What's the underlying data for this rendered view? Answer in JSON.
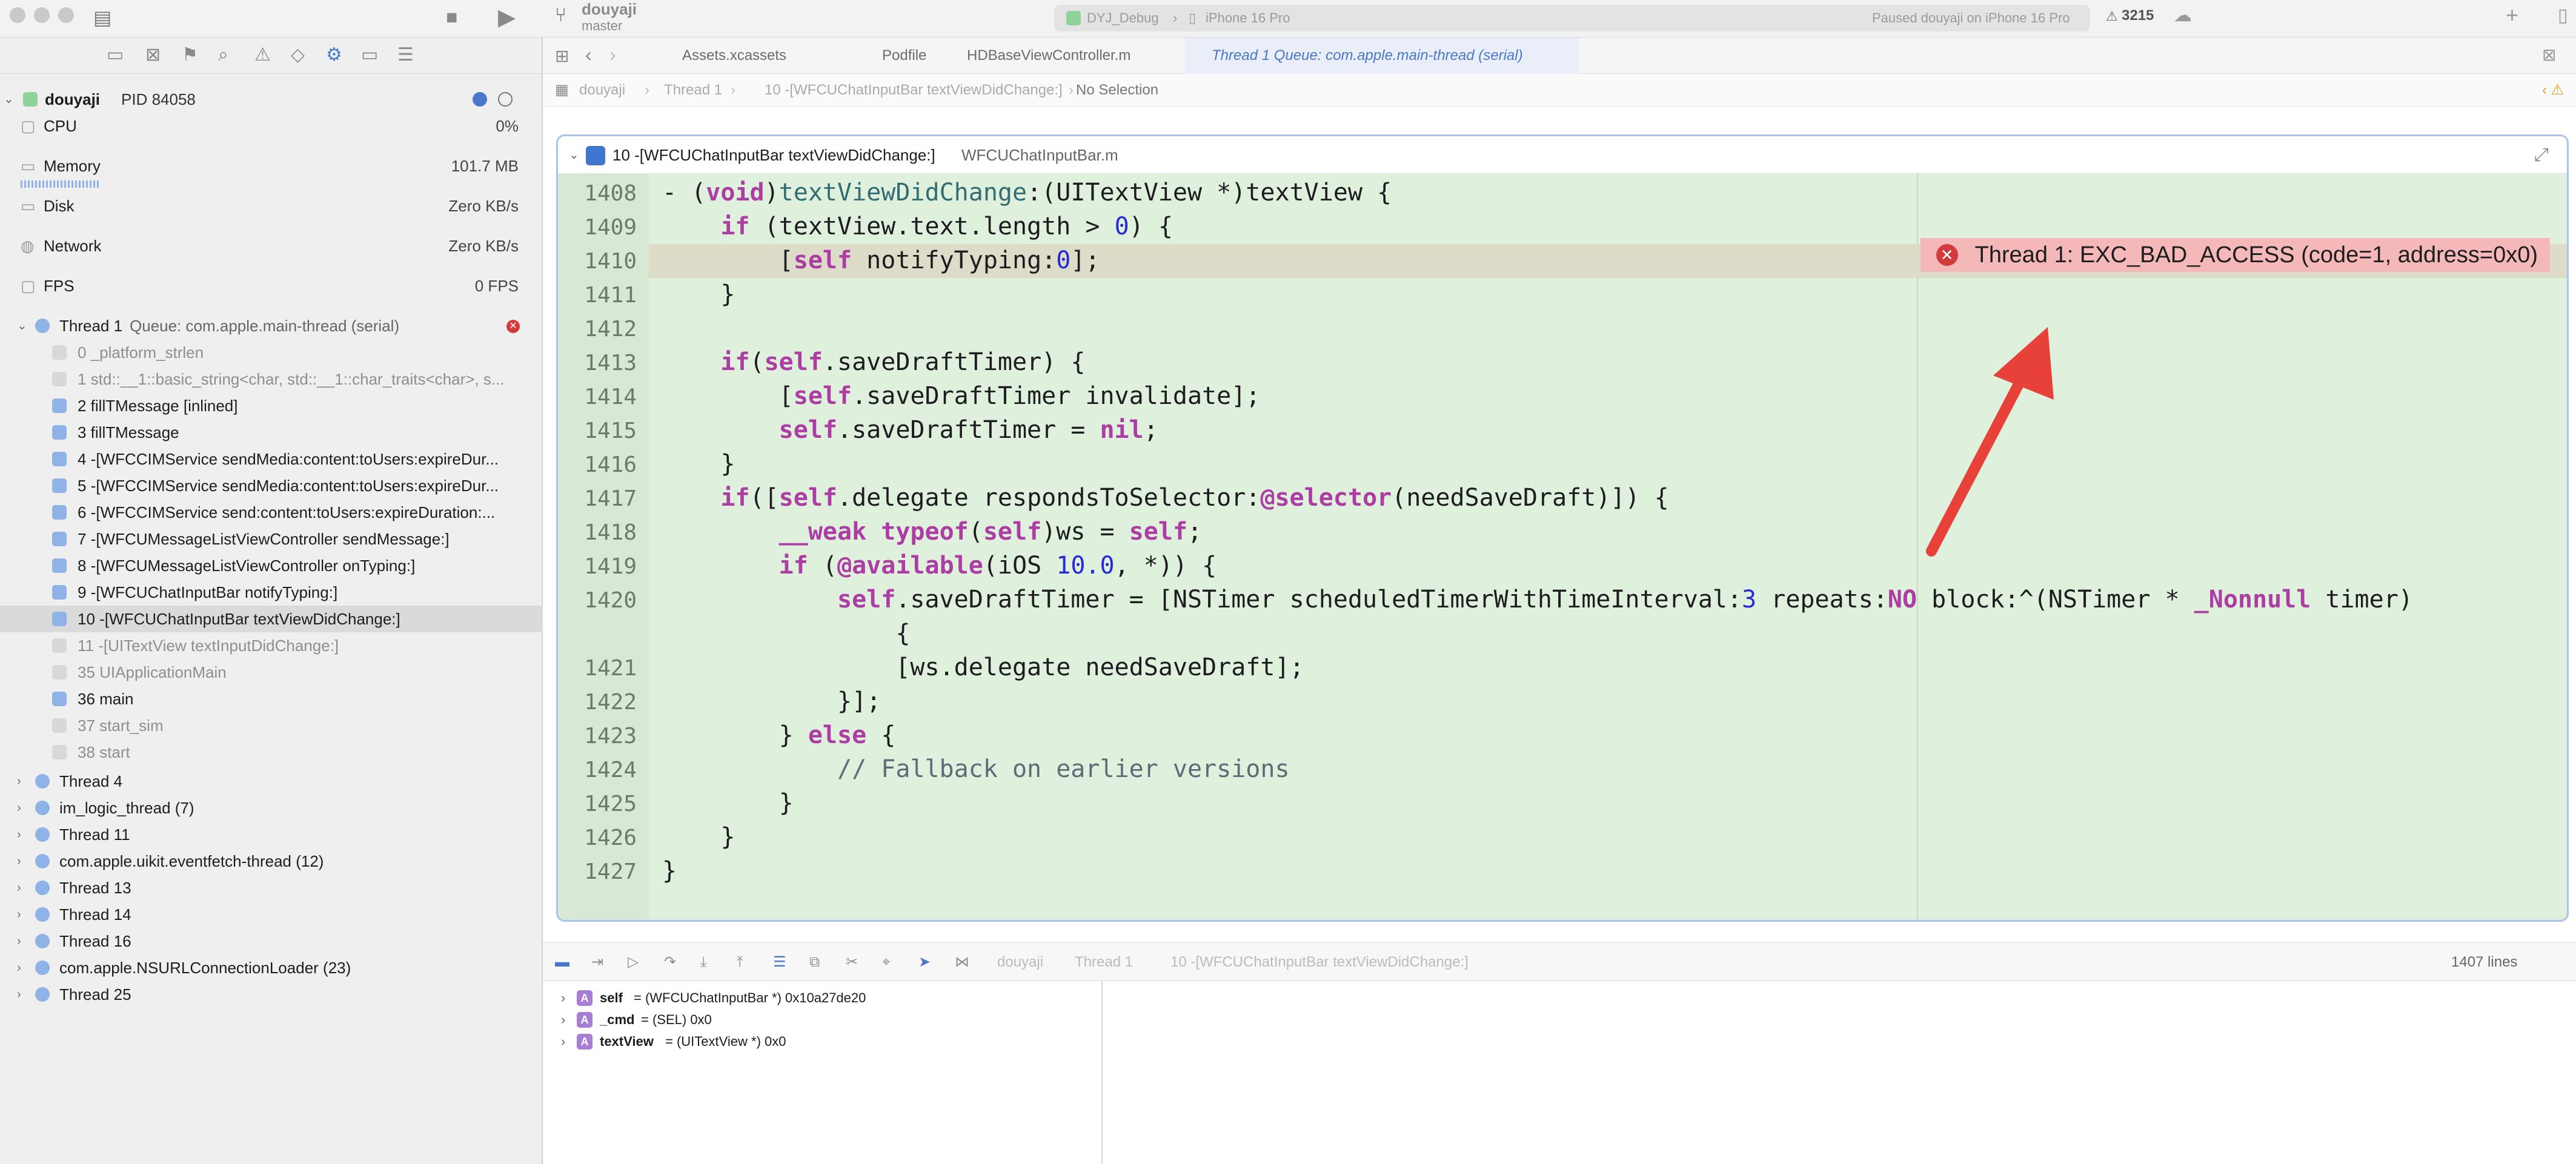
{
  "titlebar": {
    "project": "douyaji",
    "branch": "master",
    "scheme": "DYJ_Debug",
    "device": "iPhone 16 Pro",
    "status": "Paused douyaji on iPhone 16 Pro",
    "badge_count": "3215"
  },
  "navigator": {
    "process": "douyaji",
    "pid": "PID 84058",
    "gauges": [
      {
        "name": "CPU",
        "value": "0%"
      },
      {
        "name": "Memory",
        "value": "101.7 MB"
      },
      {
        "name": "Disk",
        "value": "Zero KB/s"
      },
      {
        "name": "Network",
        "value": "Zero KB/s"
      },
      {
        "name": "FPS",
        "value": "0 FPS"
      }
    ],
    "thread1": {
      "name": "Thread 1",
      "queue": "Queue: com.apple.main-thread (serial)"
    },
    "frames": [
      {
        "label": "0 _platform_strlen",
        "muted": true
      },
      {
        "label": "1 std::__1::basic_string<char, std::__1::char_traits<char>, s...",
        "muted": true
      },
      {
        "label": "2 fillTMessage [inlined]",
        "muted": false
      },
      {
        "label": "3 fillTMessage",
        "muted": false
      },
      {
        "label": "4 -[WFCCIMService sendMedia:content:toUsers:expireDur...",
        "muted": false
      },
      {
        "label": "5 -[WFCCIMService sendMedia:content:toUsers:expireDur...",
        "muted": false
      },
      {
        "label": "6 -[WFCCIMService send:content:toUsers:expireDuration:...",
        "muted": false
      },
      {
        "label": "7 -[WFCUMessageListViewController sendMessage:]",
        "muted": false
      },
      {
        "label": "8 -[WFCUMessageListViewController onTyping:]",
        "muted": false
      },
      {
        "label": "9 -[WFCUChatInputBar notifyTyping:]",
        "muted": false
      },
      {
        "label": "10 -[WFCUChatInputBar textViewDidChange:]",
        "muted": false,
        "selected": true
      },
      {
        "label": "11 -[UITextView textInputDidChange:]",
        "muted": true
      },
      {
        "label": "35 UIApplicationMain",
        "muted": true
      },
      {
        "label": "36 main",
        "muted": false
      },
      {
        "label": "37 start_sim",
        "muted": true
      },
      {
        "label": "38 start",
        "muted": true
      }
    ],
    "threads": [
      "Thread 4",
      "im_logic_thread (7)",
      "Thread 11",
      "com.apple.uikit.eventfetch-thread (12)",
      "Thread 13",
      "Thread 14",
      "Thread 16",
      "com.apple.NSURLConnectionLoader (23)",
      "Thread 25"
    ]
  },
  "tabs": [
    {
      "label": "Assets.xcassets",
      "active": false
    },
    {
      "label": "Podfile",
      "active": false
    },
    {
      "label": "HDBaseViewController.m",
      "active": false
    },
    {
      "label": "Thread 1 Queue: com.apple.main-thread (serial)",
      "active": true
    }
  ],
  "jumpbar": {
    "items": [
      "douyaji",
      "Thread 1",
      "10 -[WFCUChatInputBar textViewDidChange:]",
      "No Selection"
    ]
  },
  "code_header": {
    "frame": "10 -[WFCUChatInputBar textViewDidChange:]",
    "file": "WFCUChatInputBar.m"
  },
  "code_lines": [
    {
      "n": "1408",
      "text": "- (void)textViewDidChange:(UITextView *)textView {"
    },
    {
      "n": "1409",
      "text": "    if (textView.text.length > 0) {"
    },
    {
      "n": "1410",
      "text": "        [self notifyTyping:0];"
    },
    {
      "n": "1411",
      "text": "    }"
    },
    {
      "n": "1412",
      "text": ""
    },
    {
      "n": "1413",
      "text": "    if(self.saveDraftTimer) {"
    },
    {
      "n": "1414",
      "text": "        [self.saveDraftTimer invalidate];"
    },
    {
      "n": "1415",
      "text": "        self.saveDraftTimer = nil;"
    },
    {
      "n": "1416",
      "text": "    }"
    },
    {
      "n": "1417",
      "text": "    if([self.delegate respondsToSelector:@selector(needSaveDraft)]) {"
    },
    {
      "n": "1418",
      "text": "        __weak typeof(self)ws = self;"
    },
    {
      "n": "1419",
      "text": "        if (@available(iOS 10.0, *)) {"
    },
    {
      "n": "1420",
      "text": "            self.saveDraftTimer = [NSTimer scheduledTimerWithTimeInterval:3 repeats:NO block:^(NSTimer * _Nonnull timer)"
    },
    {
      "n": "",
      "text": "                {"
    },
    {
      "n": "1421",
      "text": "                [ws.delegate needSaveDraft];"
    },
    {
      "n": "1422",
      "text": "            }];"
    },
    {
      "n": "1423",
      "text": "        } else {"
    },
    {
      "n": "1424",
      "text": "            // Fallback on earlier versions"
    },
    {
      "n": "1425",
      "text": "        }"
    },
    {
      "n": "1426",
      "text": "    }"
    },
    {
      "n": "1427",
      "text": "}"
    }
  ],
  "error": {
    "message": "Thread 1: EXC_BAD_ACCESS (code=1, address=0x0)"
  },
  "debugbar": {
    "crumbs": [
      "douyaji",
      "Thread 1",
      "10 -[WFCUChatInputBar textViewDidChange:]"
    ],
    "lines": "1407 lines"
  },
  "variables": [
    {
      "name": "self",
      "value": "= (WFCUChatInputBar *) 0x10a27de20"
    },
    {
      "name": "_cmd",
      "value": "= (SEL) 0x0"
    },
    {
      "name": "textView",
      "value": "= (UITextView *) 0x0"
    }
  ],
  "colors": {
    "code_bg": "#dff0dc",
    "error_banner": "#f5b8b8",
    "arrow": "#e8413a",
    "keyword": "#ad3da4"
  }
}
